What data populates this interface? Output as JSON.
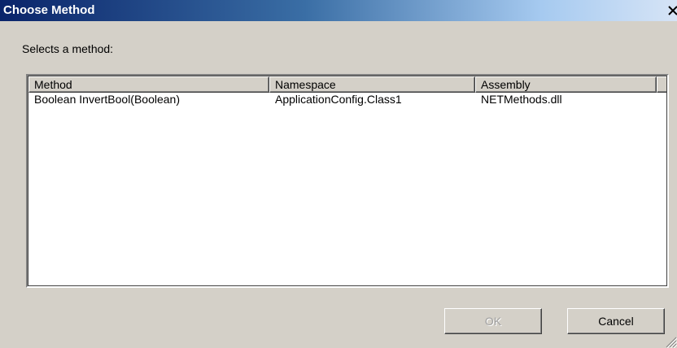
{
  "window": {
    "title": "Choose Method",
    "close_glyph": "✕"
  },
  "prompt": "Selects a method:",
  "listview": {
    "columns": [
      "Method",
      "Namespace",
      "Assembly"
    ],
    "rows": [
      [
        "Boolean InvertBool(Boolean)",
        "ApplicationConfig.Class1",
        "NETMethods.dll"
      ]
    ]
  },
  "buttons": {
    "ok_label": "OK",
    "ok_enabled": false,
    "cancel_label": "Cancel"
  },
  "icons": {
    "close": "close-icon",
    "resize": "resize-grip-icon"
  }
}
